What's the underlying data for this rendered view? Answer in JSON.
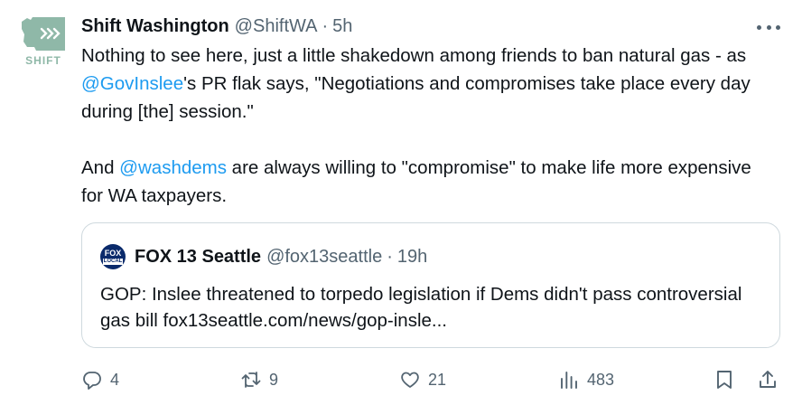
{
  "author": {
    "avatar_text": "SHIFT",
    "display_name": "Shift Washington",
    "handle": "@ShiftWA",
    "separator": "·",
    "time": "5h"
  },
  "tweet": {
    "p1_before": "Nothing to see here, just a little shakedown among friends to ban natural gas - as ",
    "p1_mention": "@GovInslee",
    "p1_after": "'s PR flak says, \"Negotiations and compromises take place every day during [the] session.\"",
    "p2_before": "And ",
    "p2_mention": "@washdems",
    "p2_after": " are always willing to \"compromise\" to make life more expensive for WA taxpayers."
  },
  "quote": {
    "logo_line1": "FOX",
    "logo_line2": "LOCAL",
    "display_name": "FOX 13 Seattle",
    "handle": "@fox13seattle",
    "separator": "·",
    "time": "19h",
    "text": "GOP: Inslee threatened to torpedo legislation if Dems didn't pass controversial gas bill fox13seattle.com/news/gop-insle..."
  },
  "actions": {
    "replies": "4",
    "retweets": "9",
    "likes": "21",
    "views": "483"
  },
  "icons": {
    "more": "more-horizontal-icon",
    "reply": "reply-icon",
    "retweet": "retweet-icon",
    "like": "heart-icon",
    "views": "views-chart-icon",
    "bookmark": "bookmark-icon",
    "share": "share-icon"
  },
  "colors": {
    "text": "#0f1419",
    "muted": "#536471",
    "link": "#1d9bf0",
    "border": "#cfd9de",
    "avatar_green": "#8fb8a8"
  }
}
